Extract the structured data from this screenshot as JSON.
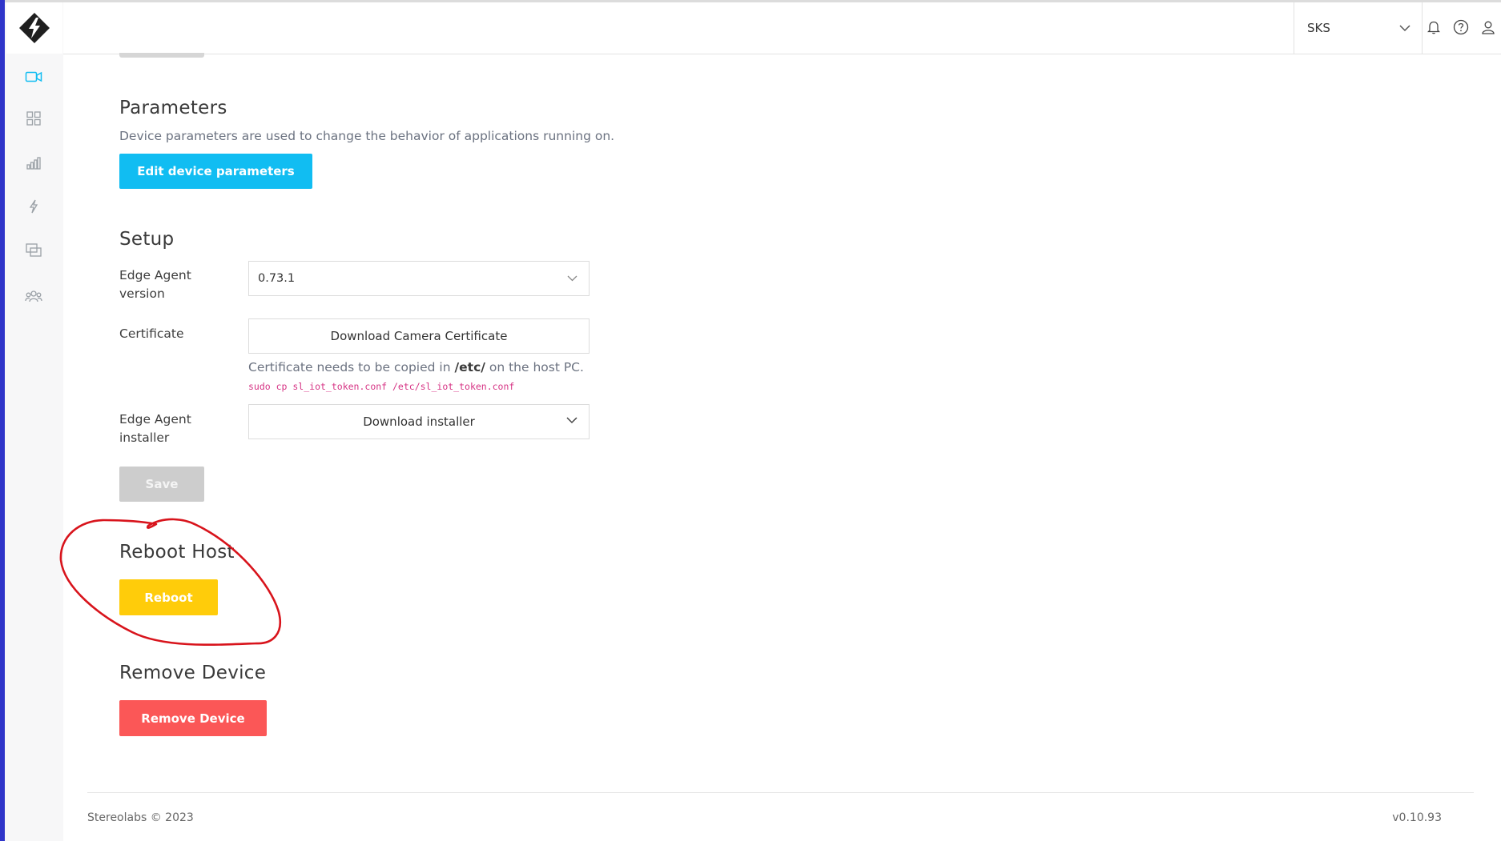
{
  "header": {
    "org_value": "SKS",
    "icons": [
      "bell-icon",
      "help-icon",
      "user-icon"
    ]
  },
  "sidebar": {
    "items": [
      {
        "name": "video-camera-icon",
        "active": true
      },
      {
        "name": "grid-icon"
      },
      {
        "name": "bar-chart-icon"
      },
      {
        "name": "lightning-icon"
      },
      {
        "name": "screens-icon"
      },
      {
        "name": "team-icon"
      }
    ]
  },
  "parameters": {
    "title": "Parameters",
    "description": "Device parameters are used to change the behavior of applications running on.",
    "button_label": "Edit device parameters"
  },
  "setup": {
    "title": "Setup",
    "edge_agent_version_label_line1": "Edge Agent",
    "edge_agent_version_label_line2": "version",
    "edge_agent_version_value": "0.73.1",
    "certificate_label": "Certificate",
    "certificate_button": "Download Camera Certificate",
    "hint_prefix": "Certificate needs to be copied in ",
    "hint_path": "/etc/",
    "hint_suffix": " on the host PC.",
    "command": "sudo cp sl_iot_token.conf /etc/sl_iot_token.conf",
    "installer_label_line1": "Edge Agent",
    "installer_label_line2": "installer",
    "installer_button": "Download installer",
    "save_label": "Save"
  },
  "reboot": {
    "title": "Reboot Host",
    "button_label": "Reboot"
  },
  "remove": {
    "title": "Remove Device",
    "button_label": "Remove Device"
  },
  "footer": {
    "copyright": "Stereolabs © 2023",
    "version": "v0.10.93"
  },
  "colors": {
    "accent_cyan": "#11bdf2",
    "reboot_yellow": "#ffcc0a",
    "remove_red": "#fb5757",
    "annotation_red": "#d8141c"
  }
}
